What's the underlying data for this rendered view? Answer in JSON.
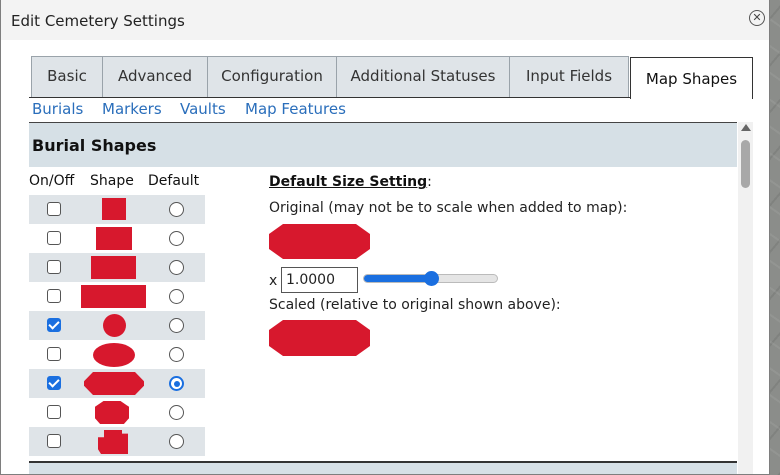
{
  "dialog": {
    "title": "Edit Cemetery Settings",
    "close_icon": "circle-x-icon"
  },
  "tabs": [
    {
      "label": "Basic",
      "active": false
    },
    {
      "label": "Advanced",
      "active": false
    },
    {
      "label": "Configuration",
      "active": false
    },
    {
      "label": "Additional Statuses",
      "active": false
    },
    {
      "label": "Input Fields",
      "active": false
    },
    {
      "label": "Map Shapes",
      "active": true
    }
  ],
  "subnav": [
    "Burials",
    "Markers",
    "Vaults",
    "Map Features"
  ],
  "section": {
    "title": "Burial Shapes",
    "columns": {
      "onoff": "On/Off",
      "shape": "Shape",
      "default": "Default"
    }
  },
  "shapes": [
    {
      "shape": "square-small",
      "on": false,
      "default": false
    },
    {
      "shape": "square-medium",
      "on": false,
      "default": false
    },
    {
      "shape": "rectangle-wide",
      "on": false,
      "default": false
    },
    {
      "shape": "rectangle-large",
      "on": false,
      "default": false
    },
    {
      "shape": "circle",
      "on": true,
      "default": false
    },
    {
      "shape": "ellipse",
      "on": false,
      "default": false
    },
    {
      "shape": "coffin",
      "on": true,
      "default": true
    },
    {
      "shape": "urn",
      "on": false,
      "default": false
    },
    {
      "shape": "bag",
      "on": false,
      "default": false
    }
  ],
  "default_size": {
    "heading": "Default Size Setting",
    "colon": ":",
    "original_label": "Original (may not be to scale when added to map):",
    "multiplier_prefix": "x",
    "scale_value": "1.0000",
    "slider_level": 0.5,
    "scaled_label": "Scaled (relative to original shown above):"
  },
  "colors": {
    "shape_fill": "#d7182d",
    "accent": "#1a6fe0",
    "section_bg": "#d6e0e6",
    "tab_bg": "#dfe4e8"
  }
}
